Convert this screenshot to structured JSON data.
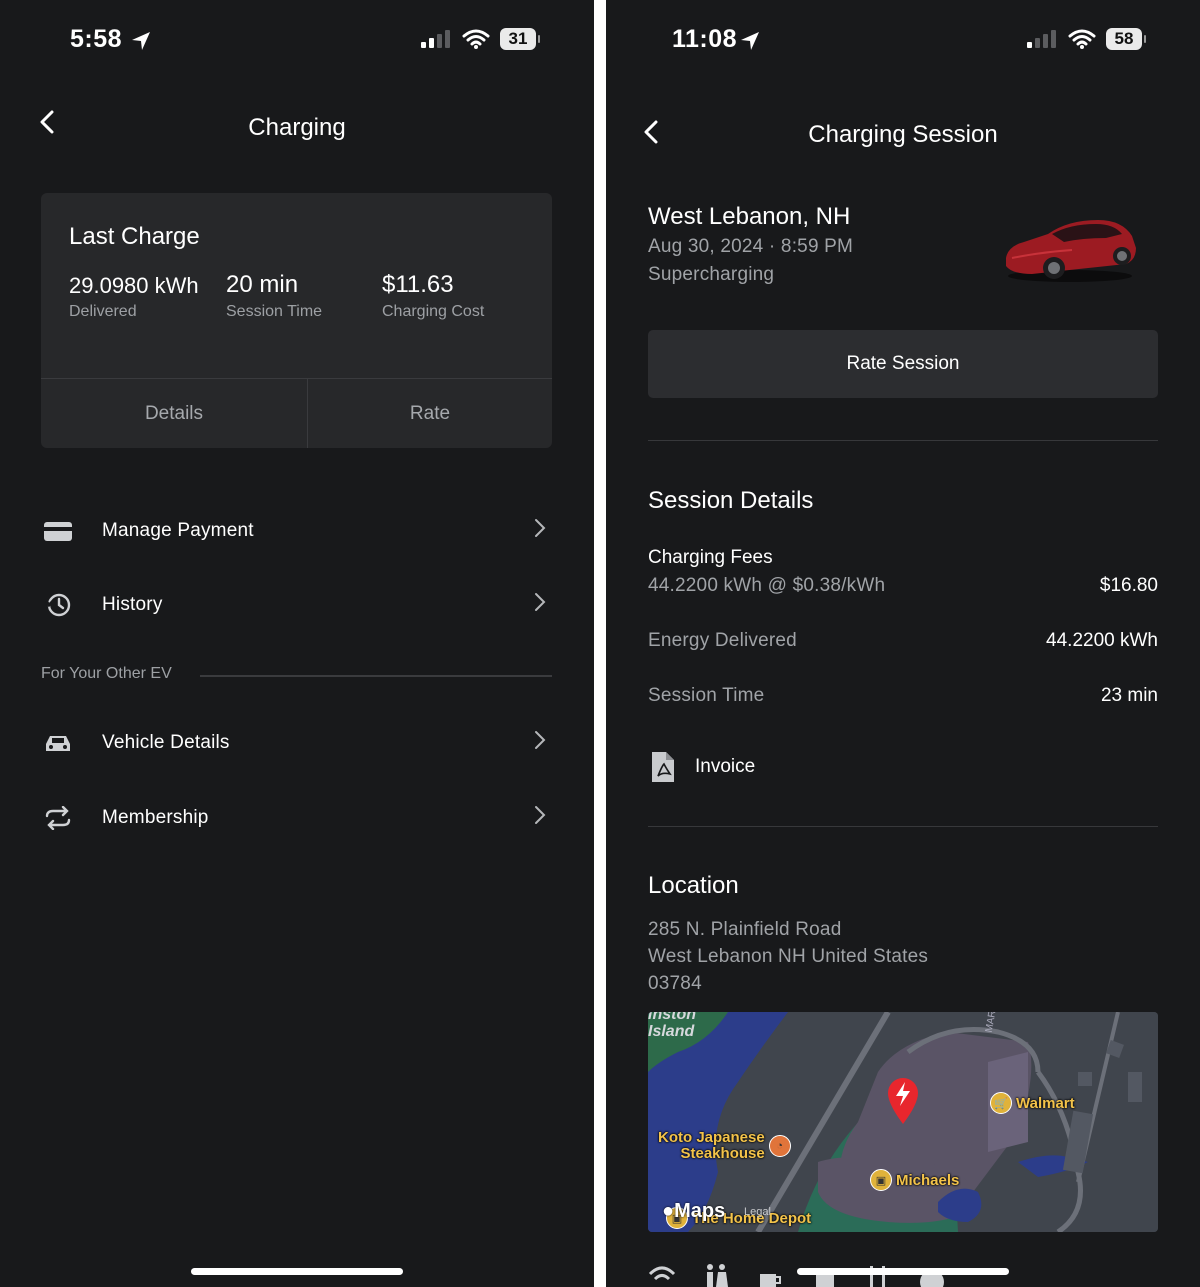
{
  "left": {
    "status": {
      "time": "5:58",
      "battery": "31"
    },
    "title": "Charging",
    "last_charge": {
      "heading": "Last Charge",
      "energy_value": "29.0980 kWh",
      "energy_label": "Delivered",
      "time_value": "20 min",
      "time_label": "Session Time",
      "cost_value": "$11.63",
      "cost_label": "Charging Cost",
      "details_button": "Details",
      "rate_button": "Rate"
    },
    "menu": {
      "manage_payment": "Manage Payment",
      "history": "History",
      "section_label": "For Your Other EV",
      "vehicle_details": "Vehicle Details",
      "membership": "Membership"
    }
  },
  "right": {
    "status": {
      "time": "11:08",
      "battery": "58"
    },
    "title": "Charging Session",
    "location_name": "West Lebanon, NH",
    "datetime": "Aug 30, 2024 · 8:59 PM",
    "charge_type": "Supercharging",
    "rate_button": "Rate Session",
    "session_details": {
      "heading": "Session Details",
      "fees_label": "Charging Fees",
      "fees_detail": "44.2200 kWh @ $0.38/kWh",
      "fees_value": "$16.80",
      "energy_label": "Energy Delivered",
      "energy_value": "44.2200 kWh",
      "time_label": "Session Time",
      "time_value": "23 min",
      "invoice_label": "Invoice"
    },
    "location": {
      "heading": "Location",
      "address_line1": "285 N. Plainfield Road",
      "address_line2": "West Lebanon NH United States",
      "address_line3": "03784"
    },
    "map": {
      "island_label_1": "inston",
      "island_label_2": "Island",
      "poi_walmart": "Walmart",
      "poi_koto_1": "Koto Japanese",
      "poi_koto_2": "Steakhouse",
      "poi_michaels": "Michaels",
      "poi_home_depot": "The Home Depot",
      "attribution": "Maps",
      "legal": "Legal",
      "road_label": "MAR"
    }
  },
  "colors": {
    "background": "#18191b",
    "card": "#27282a",
    "accent_red": "#e8262d",
    "poi_gold": "#f3c34a"
  }
}
